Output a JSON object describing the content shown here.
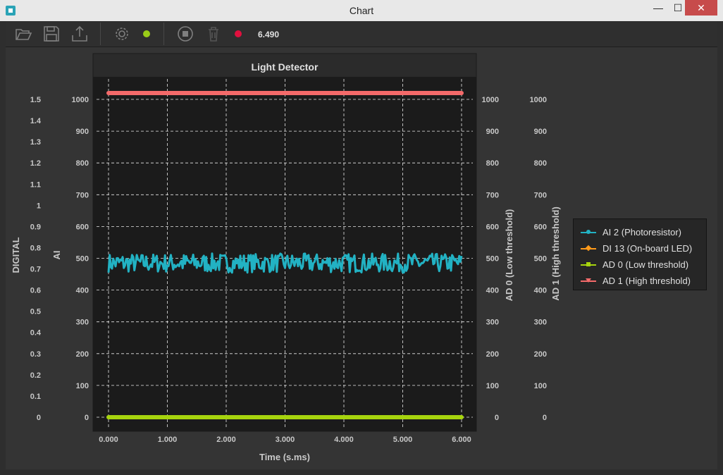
{
  "window": {
    "title": "Chart",
    "minimize": "—",
    "maximize": "☐",
    "close": "✕"
  },
  "toolbar": {
    "status_color": "#9acd18",
    "record_color": "#e0103e",
    "elapsed": "6.490"
  },
  "chart_data": {
    "type": "line",
    "title": "Light Detector",
    "xlabel": "Time (s.ms)",
    "xlim": [
      0,
      6
    ],
    "x_ticks": [
      "0.000",
      "1.000",
      "2.000",
      "3.000",
      "4.000",
      "5.000",
      "6.000"
    ],
    "grid": true,
    "legend_position": "right",
    "axes": {
      "digital": {
        "label": "DIGITAL",
        "range": [
          0,
          1.5
        ],
        "ticks": [
          "0",
          "0.1",
          "0.2",
          "0.3",
          "0.4",
          "0.5",
          "0.6",
          "0.7",
          "0.8",
          "0.9",
          "1",
          "1.1",
          "1.2",
          "1.3",
          "1.4",
          "1.5"
        ]
      },
      "ai": {
        "label": "AI",
        "range": [
          0,
          1000
        ],
        "ticks": [
          "0",
          "100",
          "200",
          "300",
          "400",
          "500",
          "600",
          "700",
          "800",
          "900",
          "1000"
        ]
      },
      "ad0": {
        "label": "AD 0 (Low threshold)",
        "range": [
          0,
          1000
        ],
        "ticks": [
          "0",
          "100",
          "200",
          "300",
          "400",
          "500",
          "600",
          "700",
          "800",
          "900",
          "1000"
        ]
      },
      "ad1": {
        "label": "AD 1 (High threshold)",
        "range": [
          0,
          1000
        ],
        "ticks": [
          "0",
          "100",
          "200",
          "300",
          "400",
          "500",
          "600",
          "700",
          "800",
          "900",
          "1000"
        ]
      }
    },
    "series": [
      {
        "name": "AI 2 (Photoresistor)",
        "color": "#22b2c3",
        "marker": "circle",
        "axis": "ai",
        "x_range": [
          0,
          6
        ],
        "y_range": [
          455,
          515
        ],
        "y_typical": 485
      },
      {
        "name": "DI 13 (On-board LED)",
        "color": "#ff9a1a",
        "marker": "diamond",
        "axis": "digital",
        "x": [],
        "y": []
      },
      {
        "name": "AD 0 (Low threshold)",
        "color": "#a7d40e",
        "marker": "square",
        "axis": "ad0",
        "x": [
          0,
          6
        ],
        "y": [
          0,
          0
        ]
      },
      {
        "name": "AD 1 (High threshold)",
        "color": "#f46a6a",
        "marker": "triangle-down",
        "axis": "ad1",
        "x": [
          0,
          6
        ],
        "y": [
          1020,
          1020
        ]
      }
    ]
  }
}
